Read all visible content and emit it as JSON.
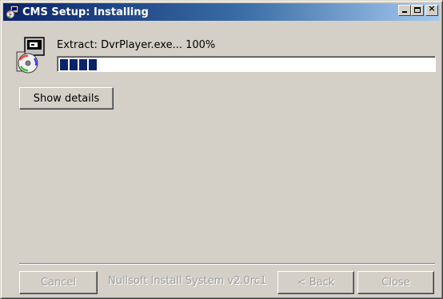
{
  "window": {
    "title": "CMS Setup: Installing",
    "controls": {
      "minimize": "_",
      "maximize": "□",
      "close": "×"
    }
  },
  "progress": {
    "status_text": "Extract: DvrPlayer.exe... 100%",
    "fraction": 0.1,
    "blocks": 4,
    "color": "#0a246a"
  },
  "buttons": {
    "show_details": "Show details",
    "cancel": "Cancel",
    "back": "< Back",
    "close": "Close"
  },
  "branding": "Nullsoft Install System v2.0rc1",
  "icons": {
    "title": "installer-icon",
    "app": "setup-cd-icon"
  },
  "colors": {
    "title_gradient_start": "#0a246a",
    "title_gradient_end": "#a6caf0",
    "dialog_bg": "#d4d0c8",
    "disabled_text": "#a0a0a0"
  }
}
